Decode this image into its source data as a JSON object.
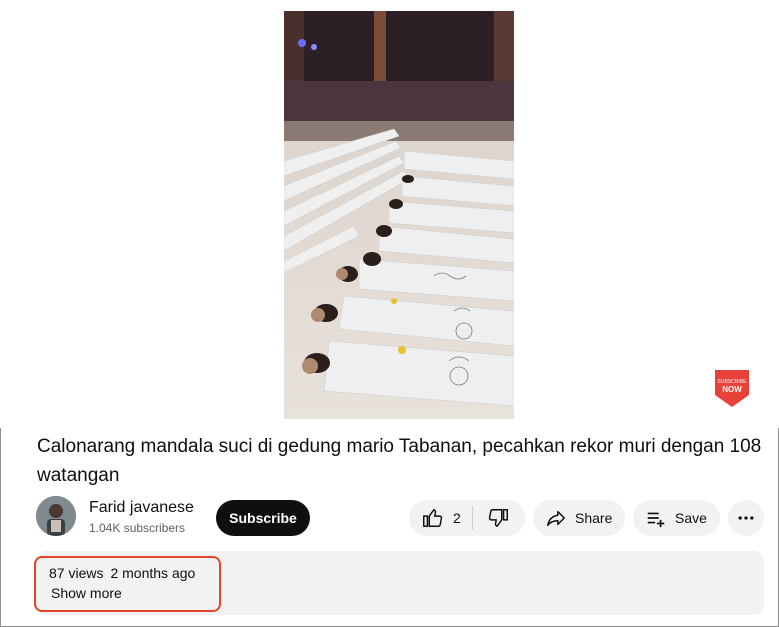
{
  "video": {
    "title": "Calonarang mandala suci di gedung mario Tabanan, pecahkan rekor muri dengan 108 watangan",
    "badge_text": "SUBSCRIBE NOW",
    "badge_color": "#e8413a"
  },
  "channel": {
    "name": "Farid javanese",
    "subscribers": "1.04K subscribers",
    "subscribe_label": "Subscribe"
  },
  "actions": {
    "like_count": "2",
    "like_icon": "thumbs-up-icon",
    "dislike_icon": "thumbs-down-icon",
    "share_label": "Share",
    "save_label": "Save",
    "more_icon": "more-horizontal-icon"
  },
  "description": {
    "views": "87 views",
    "age": "2 months ago",
    "show_more": "Show more",
    "highlight_color": "#e5452e"
  }
}
